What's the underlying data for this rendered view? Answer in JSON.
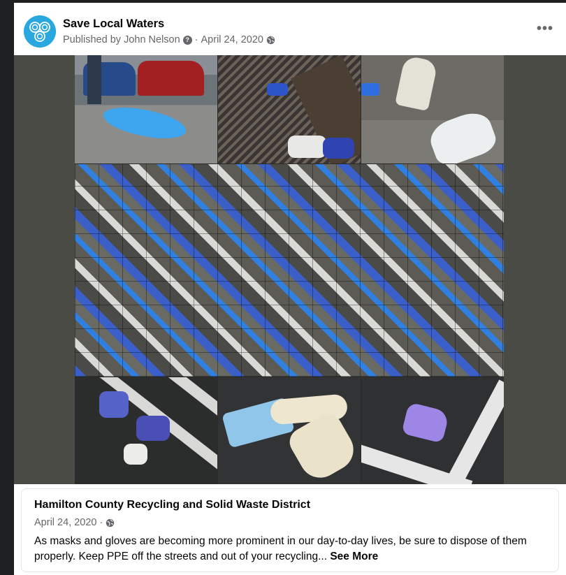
{
  "post": {
    "page_name": "Save Local Waters",
    "published_by_prefix": "Published by",
    "publisher": "John Nelson",
    "date": "April 24, 2020",
    "more_icon": "more-horizontal-icon",
    "privacy_icon": "globe-icon"
  },
  "media": {
    "description_tiles": [
      "glove-on-street",
      "glove-on-storm-grate",
      "gloves-on-pavement",
      "glove-mosaic",
      "gloves-on-parking-lines",
      "mask-and-gloves",
      "purple-glove-on-asphalt"
    ]
  },
  "shared_link": {
    "title": "Hamilton County Recycling and Solid Waste District",
    "date": "April 24, 2020",
    "text": "As masks and gloves are becoming more prominent in our day-to-day lives, be sure to dispose of them properly. Keep PPE off the streets and out of your recycling...",
    "see_more_label": "See More"
  },
  "colors": {
    "brand_blue": "#29a8e0",
    "text_primary": "#050505",
    "text_secondary": "#65676b"
  }
}
